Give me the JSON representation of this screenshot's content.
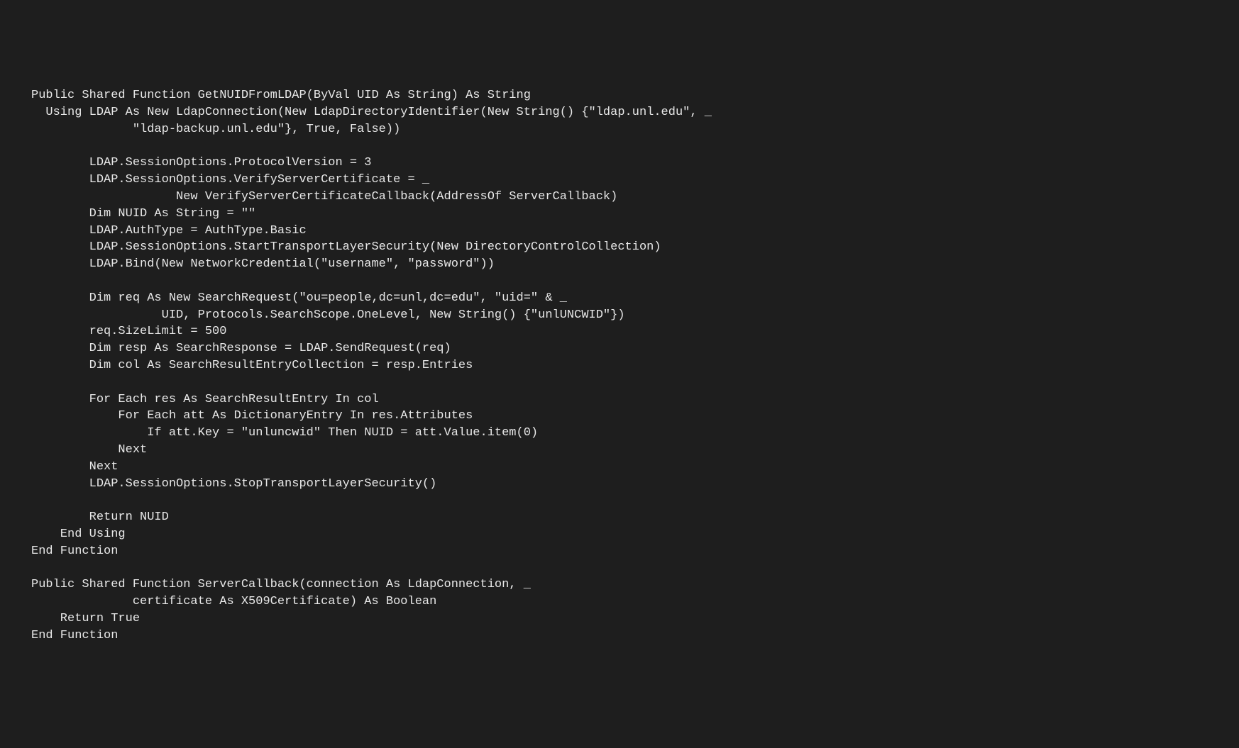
{
  "code": {
    "lines": [
      "Public Shared Function GetNUIDFromLDAP(ByVal UID As String) As String",
      "  Using LDAP As New LdapConnection(New LdapDirectoryIdentifier(New String() {\"ldap.unl.edu\", _",
      "              \"ldap-backup.unl.edu\"}, True, False))",
      "",
      "        LDAP.SessionOptions.ProtocolVersion = 3",
      "        LDAP.SessionOptions.VerifyServerCertificate = _",
      "                    New VerifyServerCertificateCallback(AddressOf ServerCallback)",
      "        Dim NUID As String = \"\"",
      "        LDAP.AuthType = AuthType.Basic",
      "        LDAP.SessionOptions.StartTransportLayerSecurity(New DirectoryControlCollection)",
      "        LDAP.Bind(New NetworkCredential(\"username\", \"password\"))",
      "",
      "        Dim req As New SearchRequest(\"ou=people,dc=unl,dc=edu\", \"uid=\" & _",
      "                  UID, Protocols.SearchScope.OneLevel, New String() {\"unlUNCWID\"})",
      "        req.SizeLimit = 500",
      "        Dim resp As SearchResponse = LDAP.SendRequest(req)",
      "        Dim col As SearchResultEntryCollection = resp.Entries",
      "",
      "        For Each res As SearchResultEntry In col",
      "            For Each att As DictionaryEntry In res.Attributes",
      "                If att.Key = \"unluncwid\" Then NUID = att.Value.item(0)",
      "            Next",
      "        Next",
      "        LDAP.SessionOptions.StopTransportLayerSecurity()",
      "",
      "        Return NUID",
      "    End Using",
      "End Function",
      "",
      "Public Shared Function ServerCallback(connection As LdapConnection, _",
      "              certificate As X509Certificate) As Boolean",
      "    Return True",
      "End Function"
    ]
  }
}
